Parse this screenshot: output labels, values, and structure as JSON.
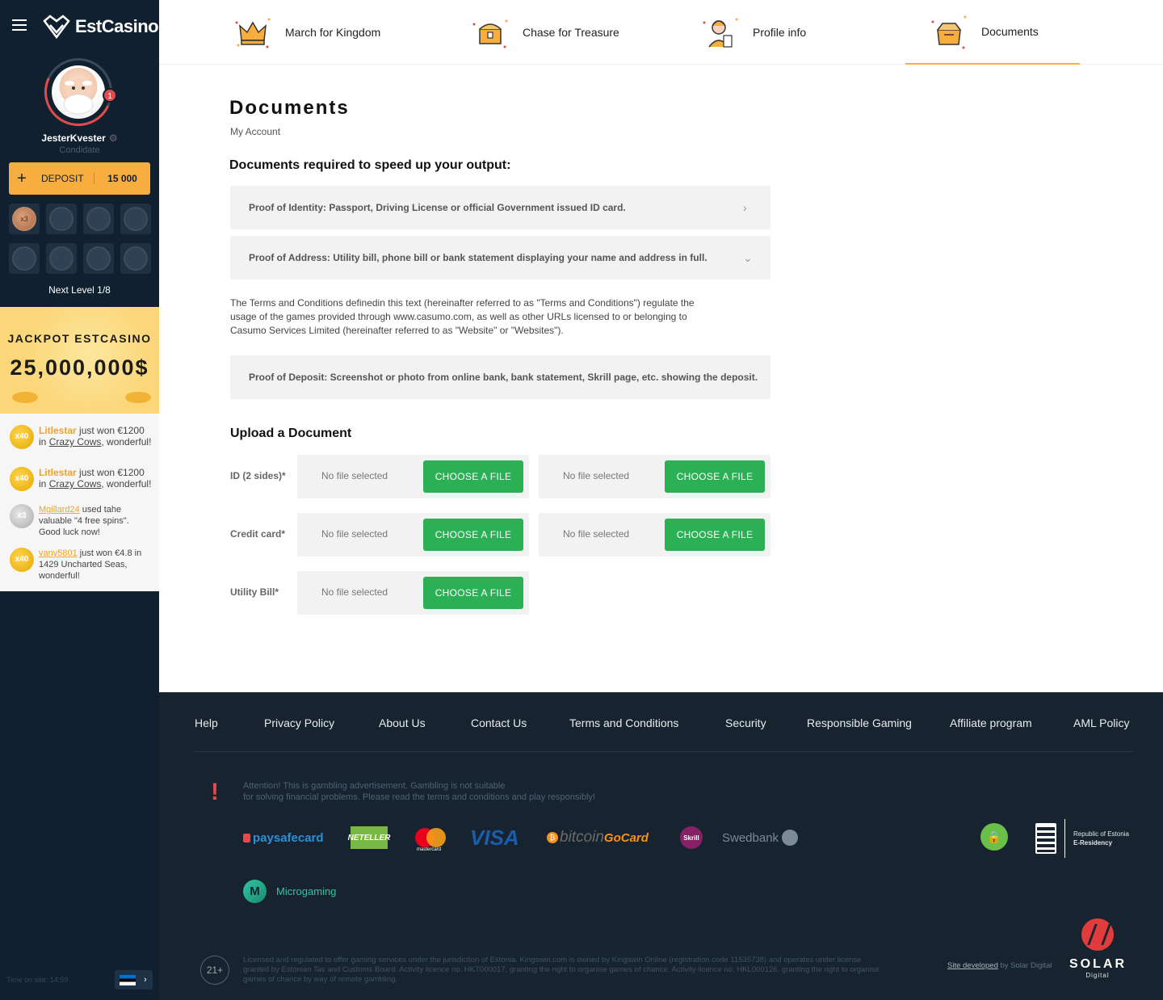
{
  "brand": {
    "name": "EstCasino"
  },
  "user": {
    "name": "JesterKvester",
    "rank": "Condidate",
    "notifications": "1",
    "deposit_label": "DEPOSIT",
    "balance": "15 000",
    "level_badge": "x3",
    "next_level": "Next Level 1/8"
  },
  "jackpot": {
    "title": "JACKPOT ESTCASINO",
    "amount": "25,000,000$"
  },
  "feed": [
    {
      "badge": "x40",
      "user": "Litlestar",
      "text1": " just won €1200 in ",
      "game": "Crazy Cows",
      "text2": ", wonderful!"
    },
    {
      "badge": "x40",
      "user": "Litlestar",
      "text1": " just won €1200 in ",
      "game": "Crazy Cows",
      "text2": ", wonderful!"
    },
    {
      "badge": "x3",
      "user": "Mgillard24",
      "text1": " used tahe valuable \"4 free spins\". Good luck now!"
    },
    {
      "badge": "x40",
      "user": "vany5801",
      "text1": " just won €4.8 in 1429 Uncharted Seas, wonderful!"
    }
  ],
  "time_on_site": "Time on site: 14:59",
  "tabs": [
    {
      "label": "March for Kingdom",
      "icon": "crown-icon"
    },
    {
      "label": "Chase for Treasure",
      "icon": "treasure-chest-icon"
    },
    {
      "label": "Profile info",
      "icon": "profile-icon"
    },
    {
      "label": "Documents",
      "icon": "box-icon",
      "active": true
    }
  ],
  "page": {
    "title": "Documents",
    "breadcrumb": "My Account",
    "required_title": "Documents required to speed up your output:",
    "accordions": [
      "Proof of Identity: Passport, Driving License or official Government issued ID card.",
      "Proof of Address: Utility bill, phone bill or bank statement displaying your name and address in full.",
      "Proof of Deposit: Screenshot or photo from online bank, bank statement, Skrill page, etc. showing the deposit."
    ],
    "terms_text": "The Terms and Conditions definedin this text (hereinafter referred to as \"Terms and Conditions\") regulate the usage of the games provided through www.casumo.com, as well as other URLs licensed to or belonging to Casumo Services Limited (hereinafter referred to as \"Website\" or \"Websites\").",
    "upload_title": "Upload a Document",
    "no_file": "No file selected",
    "choose_file": "CHOOSE A FILE",
    "upload_rows": [
      "ID (2 sides)*",
      "Credit card*",
      "Utility Bill*"
    ]
  },
  "footer": {
    "nav": [
      "Help",
      "Privacy Policy",
      "About Us",
      "Contact Us",
      "Terms and Conditions",
      "Security",
      "Responsible Gaming",
      "Affiliate program",
      "AML Policy"
    ],
    "warning_1": "Attention! This is gambling advertisement. Gambling is not suitable",
    "warning_2": "for solving financial problems. Please read the terms and conditions and play responsibly!",
    "payments": {
      "paysafe": "paysafecard",
      "neteller": "NETELLER",
      "mastercard": "mastercard",
      "visa": "VISA",
      "bitcoin": "bitcoin",
      "gocard": "GoCard",
      "skrill": "Skrill",
      "swedbank": "Swedbank"
    },
    "microgaming": "Microgaming",
    "estonia_1": "Republic of Estonia",
    "estonia_2": "E-Residency",
    "age": "21+",
    "legal": "Licensed and regulated to offer gaming services under the jurisdiction of Estonia. Kingswin.com is owned by Kingswin Online (registration code 11535738) and operates under license granted by Estonian Tax and Customs Board. Activity licence no. HKT000017, granting the right to organise games of chance. Activity licence no. HKL000126, granting the right to organise games of chance by way of remote gambling.",
    "site_dev_link": "Site developed",
    "site_dev_by": " by Solar Digital",
    "solar": "SOLAR",
    "solar_sub": "Digital"
  },
  "colors": {
    "accent": "#f8ae3e",
    "green": "#2cb055",
    "sidebar": "#10202f",
    "footer": "#17232e"
  }
}
